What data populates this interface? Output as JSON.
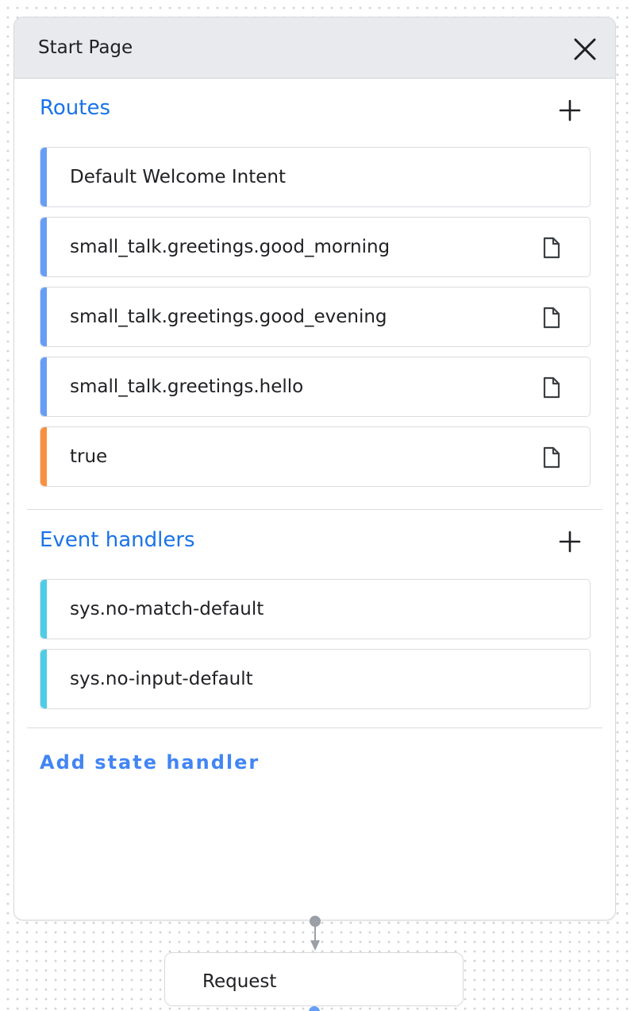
{
  "panel": {
    "title": "Start Page",
    "close_icon": "close-icon"
  },
  "routes": {
    "title": "Routes",
    "add_icon": "plus-icon",
    "items": [
      {
        "label": "Default Welcome Intent",
        "color": "#669df6",
        "has_doc_icon": false
      },
      {
        "label": "small_talk.greetings.good_morning",
        "color": "#669df6",
        "has_doc_icon": true
      },
      {
        "label": "small_talk.greetings.good_evening",
        "color": "#669df6",
        "has_doc_icon": true
      },
      {
        "label": "small_talk.greetings.hello",
        "color": "#669df6",
        "has_doc_icon": true
      },
      {
        "label": "true",
        "color": "#fa903e",
        "has_doc_icon": true
      }
    ]
  },
  "event_handlers": {
    "title": "Event handlers",
    "add_icon": "plus-icon",
    "items": [
      {
        "label": "sys.no-match-default",
        "color": "#4ecde6",
        "has_doc_icon": false
      },
      {
        "label": "sys.no-input-default",
        "color": "#4ecde6",
        "has_doc_icon": false
      }
    ]
  },
  "add_state_handler": "Add state handler",
  "request_node": {
    "label": "Request"
  },
  "colors": {
    "accent": "#1a73e8",
    "link": "#4285f4",
    "connector": "#9aa0a6",
    "port": "#669df6"
  }
}
